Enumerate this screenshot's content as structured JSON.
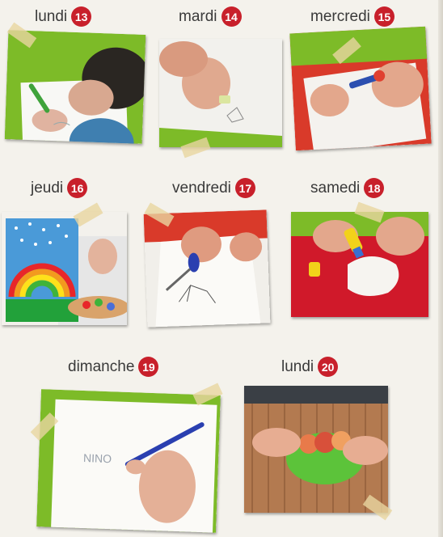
{
  "days": [
    {
      "day": "lundi",
      "number": "13",
      "caption": ""
    },
    {
      "day": "mardi",
      "number": "14"
    },
    {
      "day": "mercredi",
      "number": "15"
    },
    {
      "day": "jeudi",
      "number": "16"
    },
    {
      "day": "vendredi",
      "number": "17"
    },
    {
      "day": "samedi",
      "number": "18"
    },
    {
      "day": "dimanche",
      "number": "19",
      "written_text": "NINO"
    },
    {
      "day": "lundi",
      "number": "20"
    }
  ],
  "colors": {
    "number_badge": "#c8202b",
    "text": "#3a3a3a",
    "background": "#f4f2ec",
    "green_surface": "#7dbb28",
    "red_surface": "#d0192a"
  }
}
